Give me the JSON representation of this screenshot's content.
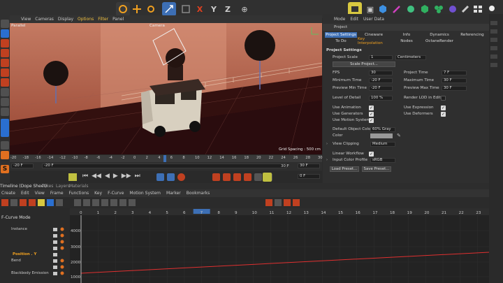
{
  "viewport": {
    "menu": [
      "View",
      "Cameras",
      "Display",
      "Options",
      "Filter",
      "Panel"
    ],
    "mode_label": "Parallel",
    "camera_label": "Camera",
    "grid_spacing": "Grid Spacing : 500 cm"
  },
  "timeline": {
    "ticks": [
      "-20",
      "-18",
      "-16",
      "-14",
      "-12",
      "-10",
      "-8",
      "-6",
      "-4",
      "-2",
      "0",
      "2",
      "4",
      "6",
      "8",
      "10",
      "12",
      "14",
      "16",
      "18",
      "20",
      "22",
      "24",
      "26",
      "28",
      "30"
    ],
    "current_frame": "0 F",
    "start": "-20 F",
    "start2": "-20 F",
    "end": "30 F",
    "end2": "30 F"
  },
  "attributes": {
    "menu": [
      "Mode",
      "Edit",
      "User Data"
    ],
    "object_label": "Project",
    "tabs_row1": [
      "Project Settings",
      "Cineware",
      "Info",
      "Dynamics",
      "Referencing"
    ],
    "tabs_row2": [
      "To Do",
      "Key Interpolation",
      "Nodes",
      "OctaneRender"
    ],
    "section_title": "Project Settings",
    "project_scale_label": "Project Scale",
    "project_scale_value": "1",
    "project_scale_unit": "Centimeters",
    "scale_project_button": "Scale Project...",
    "fps_label": "FPS",
    "fps_value": "30",
    "project_time_label": "Project Time",
    "project_time_value": "7 F",
    "min_time_label": "Minimum Time",
    "min_time_value": "-20 F",
    "max_time_label": "Maximum Time",
    "max_time_value": "30 F",
    "preview_min_label": "Preview Min Time",
    "preview_min_value": "-20 F",
    "preview_max_label": "Preview Max Time",
    "preview_max_value": "30 F",
    "lod_label": "Level of Detail",
    "lod_value": "100 %",
    "render_lod_label": "Render LOD in Editor",
    "use_animation": "Use Animation",
    "use_expression": "Use Expression",
    "use_generators": "Use Generators",
    "use_deformers": "Use Deformers",
    "use_motion": "Use Motion System",
    "default_color_label": "Default Object Color",
    "default_color_value": "60% Gray",
    "color_label": "Color",
    "view_clipping_label": "View Clipping",
    "view_clipping_value": "Medium",
    "linear_workflow_label": "Linear Workflow",
    "input_color_label": "Input Color Profile",
    "input_color_value": "sRGB",
    "load_preset": "Load Preset...",
    "save_preset": "Save Preset..."
  },
  "dope": {
    "title": "Timeline (Dope Sheet)",
    "title_tabs": [
      "Takes",
      "Layers",
      "Materials"
    ],
    "menu": [
      "Create",
      "Edit",
      "View",
      "Frame",
      "Functions",
      "Key",
      "F-Curve",
      "Motion System",
      "Marker",
      "Bookmarks"
    ],
    "mode_label": "F-Curve Mode",
    "tracks": [
      "Instance",
      "",
      "",
      "",
      "Position . Y",
      "Bend",
      "",
      "Blackbody Emission"
    ],
    "ruler": [
      "0",
      "1",
      "2",
      "3",
      "4",
      "5",
      "6",
      "7",
      "8",
      "9",
      "10",
      "11",
      "12",
      "13",
      "14",
      "15",
      "16",
      "17",
      "18",
      "19",
      "20",
      "21",
      "22",
      "23",
      "24"
    ],
    "y_axis": [
      "4000",
      "3000",
      "2000",
      "1000"
    ]
  }
}
